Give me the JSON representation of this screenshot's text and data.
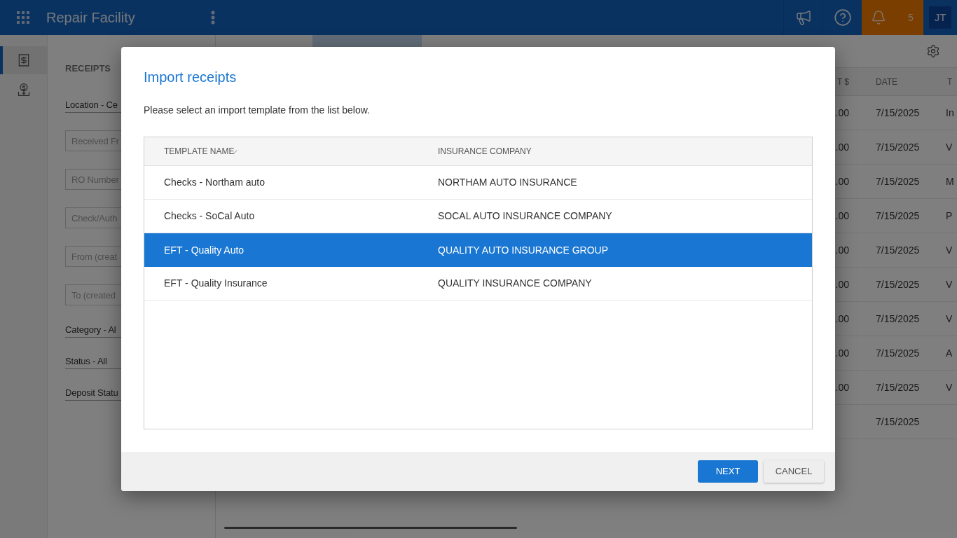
{
  "top_bar": {
    "title": "Repair Facility",
    "notification_count": "5",
    "avatar_initials": "JT"
  },
  "nav_rail": {
    "items": [
      {
        "kind": "receipt",
        "selected": true
      },
      {
        "kind": "coin",
        "selected": false
      }
    ]
  },
  "filter_panel": {
    "heading": "RECEIPTS",
    "fields": [
      {
        "kind": "dropdown",
        "value": "Location - Ce"
      },
      {
        "kind": "input",
        "placeholder": "Received Fr"
      },
      {
        "kind": "input",
        "placeholder": "RO Number"
      },
      {
        "kind": "input",
        "placeholder": "Check/Auth"
      },
      {
        "kind": "input",
        "placeholder": "From (creat"
      },
      {
        "kind": "input",
        "placeholder": "To (created"
      },
      {
        "kind": "dropdown",
        "value": "Category - Al"
      },
      {
        "kind": "dropdown",
        "value": "Status - All"
      },
      {
        "kind": "dropdown",
        "value": "Deposit Statu"
      }
    ]
  },
  "main": {
    "tabs": [
      {
        "selected": false
      },
      {
        "selected": true
      },
      {
        "selected": false
      }
    ],
    "table": {
      "columns": [
        "T $",
        "DATE",
        "T"
      ],
      "rows": [
        {
          "amount": ".00",
          "date": "7/15/2025",
          "type": "In"
        },
        {
          "amount": ".00",
          "date": "7/15/2025",
          "type": "V"
        },
        {
          "amount": ".00",
          "date": "7/15/2025",
          "type": "M"
        },
        {
          "amount": ".00",
          "date": "7/15/2025",
          "type": "P"
        },
        {
          "amount": ".00",
          "date": "7/15/2025",
          "type": "V"
        },
        {
          "amount": ".00",
          "date": "7/15/2025",
          "type": "V"
        },
        {
          "amount": ".00",
          "date": "7/15/2025",
          "type": "V"
        },
        {
          "amount": ".00",
          "date": "7/15/2025",
          "type": "A"
        },
        {
          "amount": ".00",
          "date": "7/15/2025",
          "type": "V"
        },
        {
          "date": "7/15/2025"
        }
      ]
    }
  },
  "dialog": {
    "title": "Import receipts",
    "message": "Please select an import template from the list below.",
    "table": {
      "columns": [
        "TEMPLATE NAME",
        "INSURANCE COMPANY"
      ],
      "rows": [
        {
          "template_name": "Checks - Northam auto",
          "insurance_company": "NORTHAM AUTO INSURANCE",
          "selected": false
        },
        {
          "template_name": "Checks - SoCal Auto",
          "insurance_company": "SOCAL AUTO INSURANCE COMPANY",
          "selected": false
        },
        {
          "template_name": "EFT - Quality Auto",
          "insurance_company": "QUALITY AUTO INSURANCE GROUP",
          "selected": true
        },
        {
          "template_name": "EFT - Quality Insurance",
          "insurance_company": "QUALITY INSURANCE COMPANY",
          "selected": false
        }
      ]
    },
    "buttons": [
      {
        "label": "NEXT",
        "kind": "primary"
      },
      {
        "label": "CANCEL",
        "kind": "secondary"
      }
    ]
  }
}
